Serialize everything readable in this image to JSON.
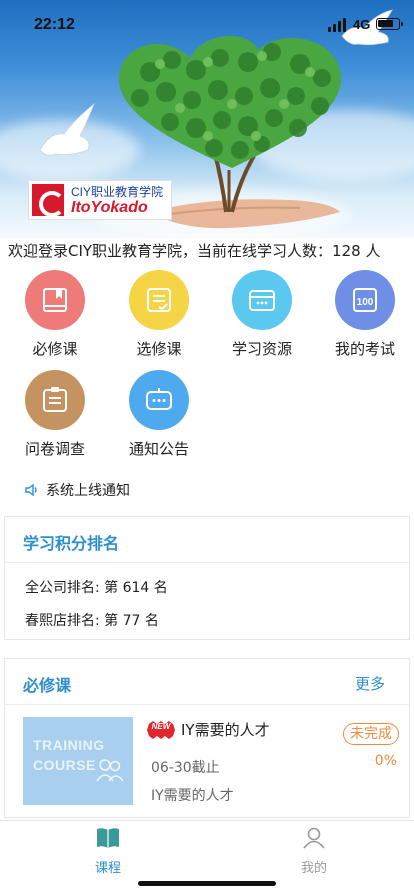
{
  "status_bar": {
    "time": "22:12",
    "network": "4G"
  },
  "banner": {
    "logo_line1": "CIY职业教育学院",
    "logo_line2": "ItoYokado"
  },
  "welcome_text": "欢迎登录CIY职业教育学院，当前在线学习人数：128 人",
  "menu": [
    {
      "label": "必修课",
      "icon": "bookmark-book-icon",
      "color": "#ef7a7a"
    },
    {
      "label": "选修课",
      "icon": "checklist-icon",
      "color": "#f5d446"
    },
    {
      "label": "学习资源",
      "icon": "folder-icon",
      "color": "#5ac8ef"
    },
    {
      "label": "我的考试",
      "icon": "exam-100-icon",
      "color": "#6f8fe6"
    },
    {
      "label": "问卷调查",
      "icon": "clipboard-icon",
      "color": "#c49361"
    },
    {
      "label": "通知公告",
      "icon": "message-icon",
      "color": "#4ea9ee"
    }
  ],
  "notice": {
    "text": "系统上线通知",
    "icon": "speaker-icon"
  },
  "ranking": {
    "title": "学习积分排名",
    "company_rank": "全公司排名: 第 614 名",
    "store_rank": "春熙店排名: 第 77 名"
  },
  "required": {
    "title": "必修课",
    "more": "更多",
    "course": {
      "badge": "NEW",
      "title": "IY需要的人才",
      "deadline": "06-30截止",
      "description": "IY需要的人才",
      "status": "未完成",
      "progress": "0%",
      "thumb_line1": "TRAINING",
      "thumb_line2": "COURSE"
    }
  },
  "tabs": [
    {
      "label": "课程",
      "icon": "book-icon",
      "active": true,
      "color": "#2e8fcf"
    },
    {
      "label": "我的",
      "icon": "user-icon",
      "active": false,
      "color": "#999999"
    }
  ]
}
